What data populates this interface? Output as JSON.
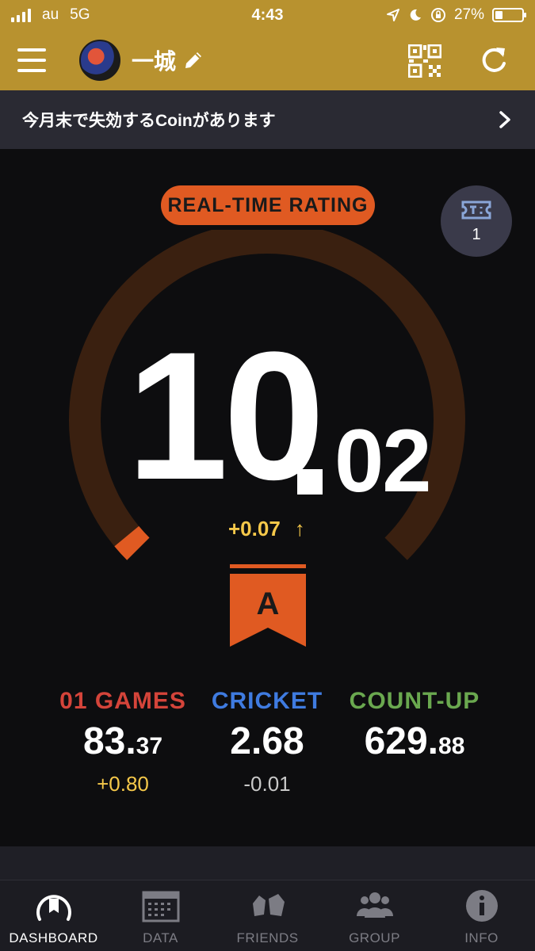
{
  "status_bar": {
    "carrier": "au",
    "network": "5G",
    "time": "4:43",
    "battery_percent": "27%",
    "battery_level": 0.27
  },
  "header": {
    "user_name": "一城",
    "menu_icon": "hamburger-menu-icon",
    "edit_icon": "pencil-icon",
    "qr_icon": "qr-code-icon",
    "refresh_icon": "refresh-icon"
  },
  "notice": {
    "text": "今月末で失効するCoinがあります"
  },
  "rating": {
    "label": "REAL-TIME RATING",
    "integer": "10",
    "decimal": "02",
    "change": "+0.07",
    "change_arrow": "↑",
    "rank": "A",
    "gauge_fraction": 0.02
  },
  "ticket": {
    "count": "1"
  },
  "stats": [
    {
      "label": "01 GAMES",
      "value_int": "83.",
      "value_dec": "37",
      "change": "+0.80",
      "label_color": "#d4443a",
      "change_color": "#f5c84a"
    },
    {
      "label": "CRICKET",
      "value_int": "2.68",
      "value_dec": "",
      "change": "-0.01",
      "label_color": "#3f7be0",
      "change_color": "#c8c8c8"
    },
    {
      "label": "COUNT-UP",
      "value_int": "629.",
      "value_dec": "88",
      "change": "",
      "label_color": "#6aa84f",
      "change_color": "#c8c8c8"
    }
  ],
  "tabs": [
    {
      "label": "DASHBOARD",
      "icon": "dashboard-icon",
      "active": true
    },
    {
      "label": "DATA",
      "icon": "calendar-icon",
      "active": false
    },
    {
      "label": "FRIENDS",
      "icon": "friends-icon",
      "active": false
    },
    {
      "label": "GROUP",
      "icon": "group-icon",
      "active": false
    },
    {
      "label": "INFO",
      "icon": "info-icon",
      "active": false
    }
  ],
  "colors": {
    "header_bg": "#b8922f",
    "accent_orange": "#e05a22",
    "gauge_track": "#3a2010"
  }
}
